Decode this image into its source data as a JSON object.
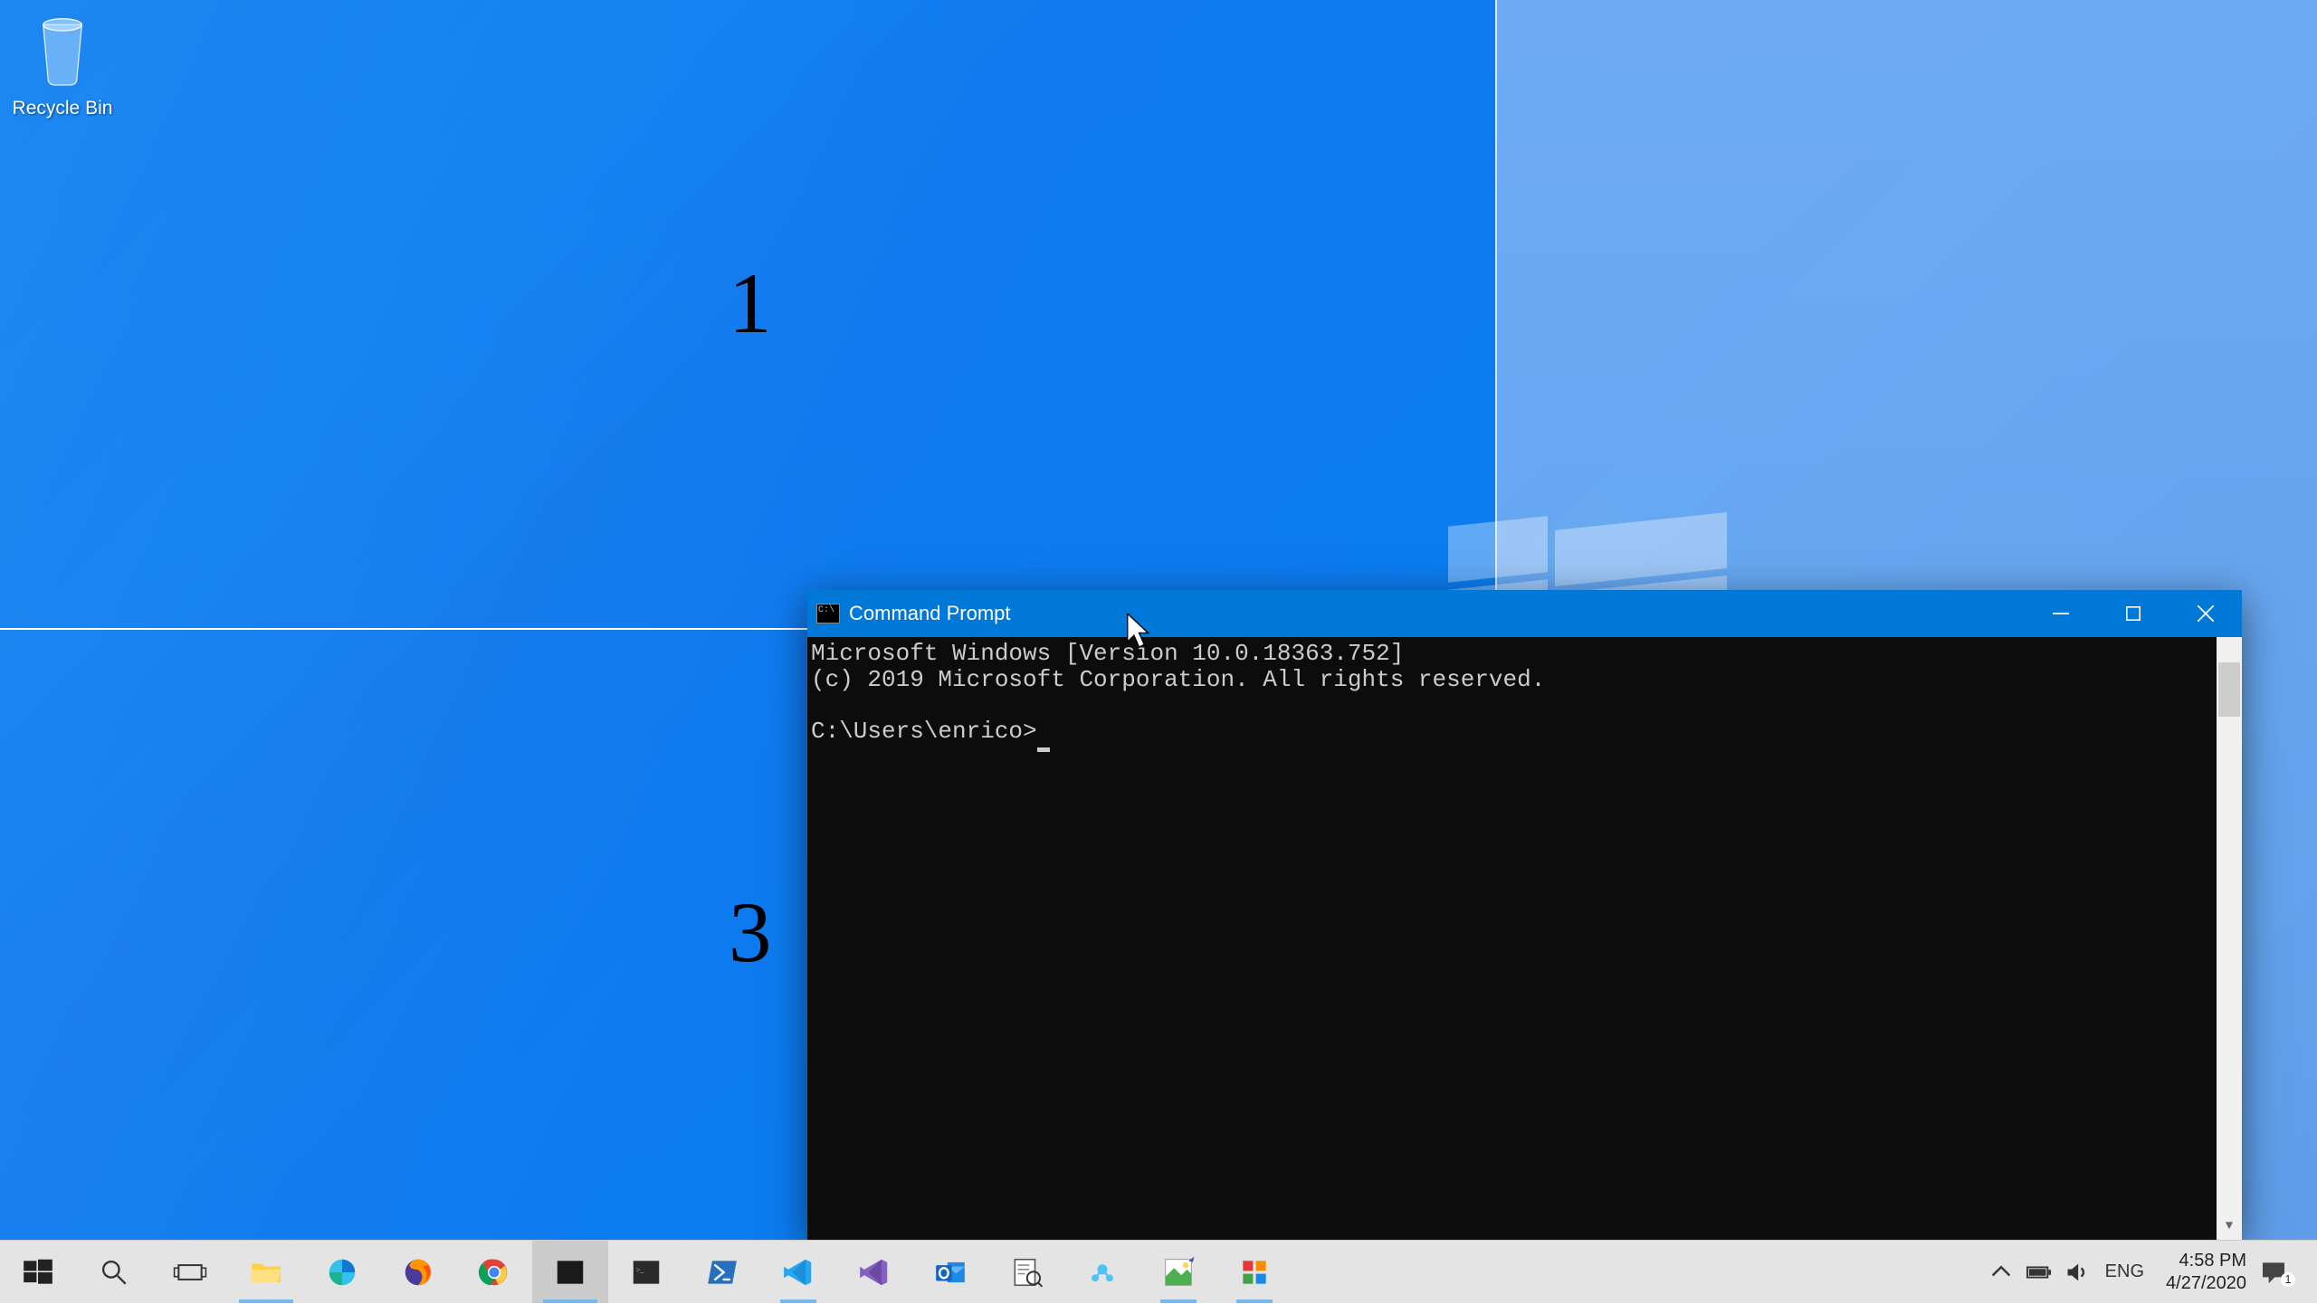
{
  "desktop": {
    "icons": [
      {
        "label": "Recycle Bin"
      }
    ],
    "zones": {
      "one": "1",
      "three": "3"
    }
  },
  "cmd": {
    "title": "Command Prompt",
    "line1": "Microsoft Windows [Version 10.0.18363.752]",
    "line2": "(c) 2019 Microsoft Corporation. All rights reserved.",
    "prompt": "C:\\Users\\enrico>"
  },
  "taskbar": {
    "items": [
      {
        "name": "start"
      },
      {
        "name": "search"
      },
      {
        "name": "task-view"
      },
      {
        "name": "file-explorer",
        "running": true,
        "active": false
      },
      {
        "name": "edge"
      },
      {
        "name": "firefox"
      },
      {
        "name": "chrome"
      },
      {
        "name": "cmd-dark",
        "running": true,
        "active": true
      },
      {
        "name": "cmd-dark-2"
      },
      {
        "name": "powershell"
      },
      {
        "name": "vscode",
        "running": true
      },
      {
        "name": "visual-studio"
      },
      {
        "name": "outlook"
      },
      {
        "name": "docs"
      },
      {
        "name": "azure-devops"
      },
      {
        "name": "image-editor",
        "running": true
      },
      {
        "name": "powertoys",
        "running": true
      }
    ]
  },
  "tray": {
    "lang": "ENG",
    "time": "4:58 PM",
    "date": "4/27/2020",
    "notification_count": "1"
  }
}
